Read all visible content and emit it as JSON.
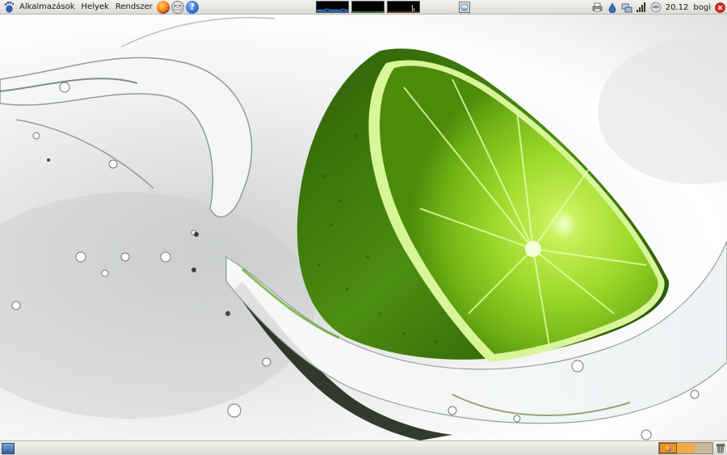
{
  "top_panel": {
    "menus": {
      "applications": "Alkalmazások",
      "places": "Helyek",
      "system": "Rendszer"
    },
    "launchers": [
      "firefox-icon",
      "evolution-icon",
      "help-icon"
    ],
    "help_glyph": "?",
    "tray_icons": [
      "printer-icon",
      "drop-icon",
      "network-manager-icon",
      "signal-strength-icon",
      "weather-icon"
    ],
    "clock": "20.12",
    "user": "bogi"
  },
  "bottom_panel": {
    "workspaces": 3,
    "active_workspace": 1
  },
  "wallpaper": {
    "subject": "lime slice splashing in water",
    "colors": {
      "lime_light": "#b6e83a",
      "lime_dark": "#3d7a0a",
      "water": "#ffffff"
    }
  }
}
